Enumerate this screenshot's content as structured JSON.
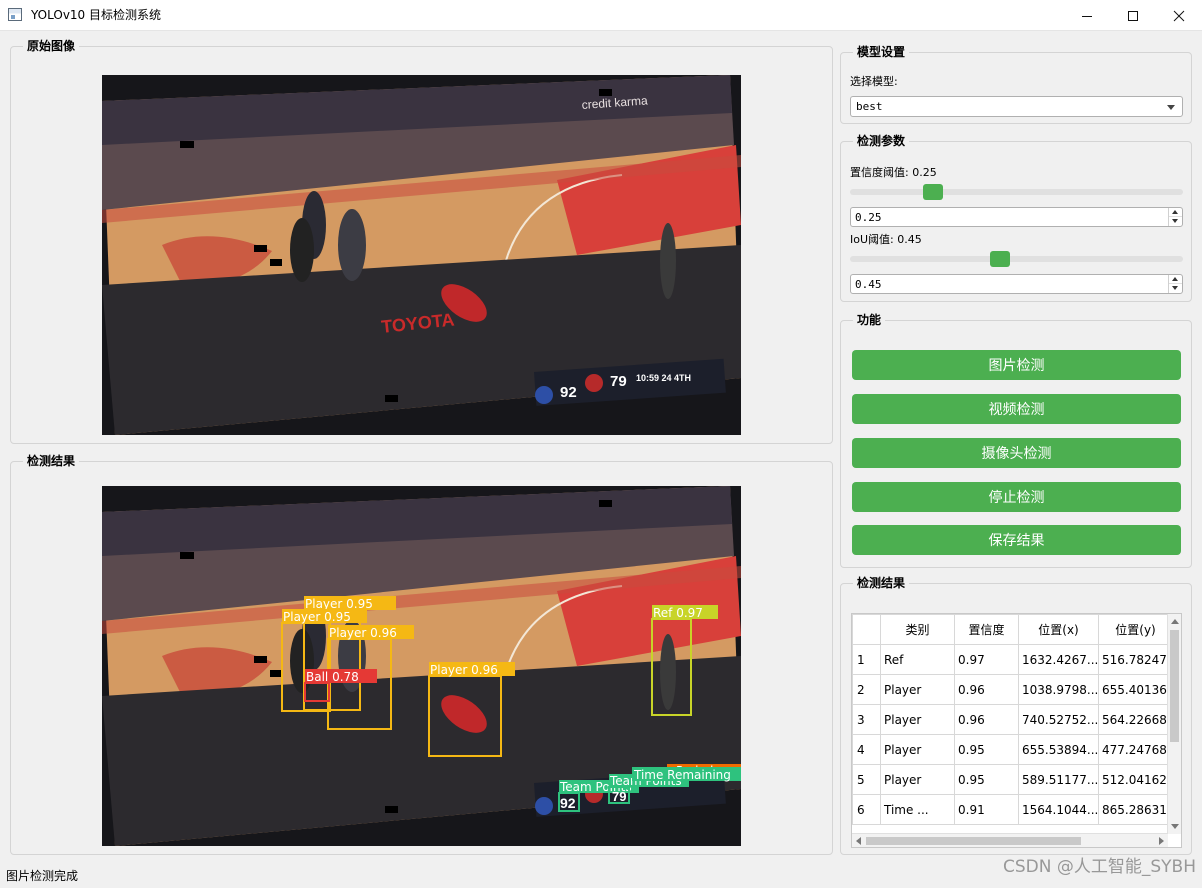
{
  "window": {
    "title": "YOLOv10 目标检测系统",
    "controls": [
      "minimize-icon",
      "maximize-icon",
      "close-icon"
    ]
  },
  "panels": {
    "original_title": "原始图像",
    "result_title": "检测结果"
  },
  "scene": {
    "scoreboard": {
      "home_score": "92",
      "away_score": "79",
      "clock": "10:59 24 4TH"
    },
    "court_text": [
      "TOYOTA",
      "credit karma"
    ]
  },
  "detections": [
    {
      "label": "Player 0.95",
      "color": "#f5b814"
    },
    {
      "label": "Player 0.95",
      "color": "#f5b814"
    },
    {
      "label": "Player 0.96",
      "color": "#f5b814"
    },
    {
      "label": "Ball 0.78",
      "color": "#e53935"
    },
    {
      "label": "Player 0.96",
      "color": "#f5b814"
    },
    {
      "label": "Ref 0.97",
      "color": "#c8d428"
    },
    {
      "label": "Team Points",
      "color": "#2ec27e"
    },
    {
      "label": "Team Points",
      "color": "#2ec27e"
    },
    {
      "label": "Time Remaining",
      "color": "#2ec27e"
    },
    {
      "label": "Period",
      "color": "#ef6c00"
    }
  ],
  "settings": {
    "model_group_title": "模型设置",
    "model_label": "选择模型:",
    "model_value": "best",
    "params_group_title": "检测参数",
    "confidence": {
      "label": "置信度阈值: 0.25",
      "value": "0.25",
      "level": 0.25
    },
    "iou": {
      "label": "IoU阈值: 0.45",
      "value": "0.45",
      "level": 0.45
    }
  },
  "functions": {
    "group_title": "功能",
    "buttons": [
      "图片检测",
      "视频检测",
      "摄像头检测",
      "停止检测",
      "保存结果"
    ]
  },
  "results": {
    "group_title": "检测结果",
    "columns": [
      "",
      "类别",
      "置信度",
      "位置(x)",
      "位置(y)"
    ],
    "rows": [
      [
        "1",
        "Ref",
        "0.97",
        "1632.4267...",
        "516.78247..."
      ],
      [
        "2",
        "Player",
        "0.96",
        "1038.9798...",
        "655.40136..."
      ],
      [
        "3",
        "Player",
        "0.96",
        "740.52752...",
        "564.22668..."
      ],
      [
        "4",
        "Player",
        "0.95",
        "655.53894...",
        "477.24768..."
      ],
      [
        "5",
        "Player",
        "0.95",
        "589.51177...",
        "512.04162..."
      ],
      [
        "6",
        "Time ...",
        "0.91",
        "1564.1044...",
        "865.28631..."
      ]
    ]
  },
  "status_text": "图片检测完成",
  "watermark": "CSDN @人工智能_SYBH"
}
